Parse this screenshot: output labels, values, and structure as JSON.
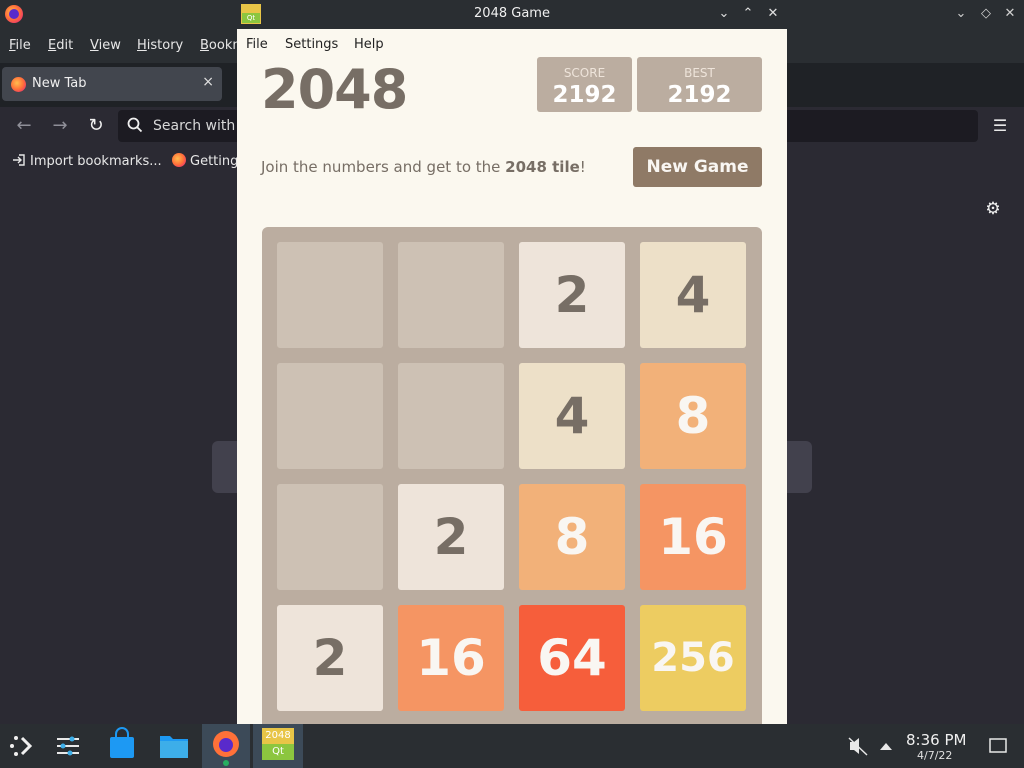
{
  "firefox": {
    "menus": [
      {
        "label": "File",
        "u": "F",
        "rest": "ile"
      },
      {
        "label": "Edit",
        "u": "E",
        "rest": "dit"
      },
      {
        "label": "View",
        "u": "V",
        "rest": "iew"
      },
      {
        "label": "History",
        "u": "H",
        "rest": "istory"
      },
      {
        "label": "Bookmarks",
        "u": "B",
        "rest": "ookm"
      }
    ],
    "tab_label": "New Tab",
    "tab_close": "×",
    "url_placeholder": "Search with G",
    "bookmarks": [
      "Import bookmarks...",
      "Getting"
    ]
  },
  "game_window": {
    "title": "2048 Game",
    "menus": [
      "File",
      "Settings",
      "Help"
    ]
  },
  "game": {
    "title": "2048",
    "score_label": "SCORE",
    "score": "2192",
    "best_label": "BEST",
    "best": "2192",
    "intro_prefix": "Join the numbers and get to the ",
    "intro_bold": "2048 tile",
    "intro_suffix": "!",
    "new_game_label": "New Game",
    "board": [
      [
        "",
        "",
        "2",
        "4"
      ],
      [
        "",
        "",
        "4",
        "8"
      ],
      [
        "",
        "2",
        "8",
        "16"
      ],
      [
        "2",
        "16",
        "64",
        "256"
      ]
    ],
    "tile_colors": {
      "2": {
        "bg": "#eee4da",
        "fg": "#776e65"
      },
      "4": {
        "bg": "#ede0c8",
        "fg": "#776e65"
      },
      "8": {
        "bg": "#f2b179",
        "fg": "#f9f6f2"
      },
      "16": {
        "bg": "#f59563",
        "fg": "#f9f6f2"
      },
      "64": {
        "bg": "#f65e3b",
        "fg": "#f9f6f2"
      },
      "256": {
        "bg": "#edcc61",
        "fg": "#f9f6f2"
      }
    }
  },
  "taskbar": {
    "qt_icon_top": "2048",
    "qt_icon_bottom": "Qt",
    "time": "8:36 PM",
    "date": "4/7/22"
  }
}
